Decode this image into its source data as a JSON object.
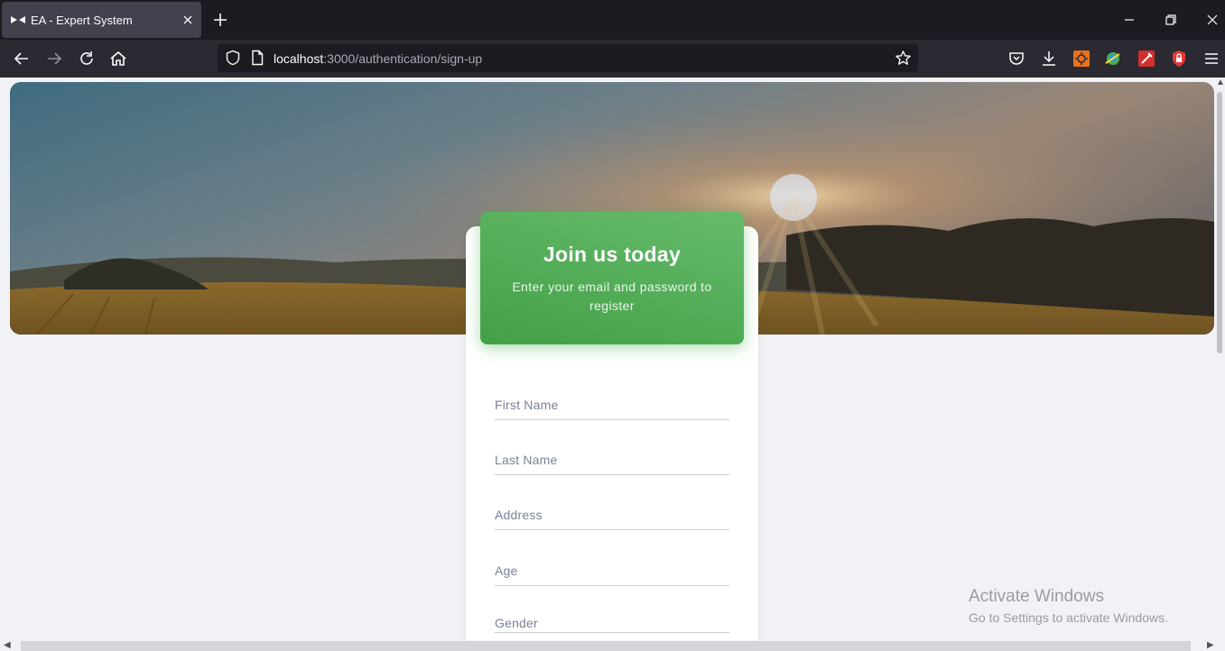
{
  "browser": {
    "tab_title": "EA - Expert System",
    "url_host": "localhost",
    "url_rest": ":3000/authentication/sign-up",
    "icons": [
      "tab-favicon-icon",
      "close-icon",
      "plus-icon",
      "minimize-icon",
      "restore-icon",
      "window-close-icon",
      "back-arrow-icon",
      "forward-arrow-icon",
      "reload-icon",
      "home-icon",
      "shield-icon",
      "page-icon",
      "star-icon",
      "pocket-icon",
      "download-icon",
      "menu-icon"
    ]
  },
  "card": {
    "title": "Join us today",
    "subtitle": "Enter your email and password to register"
  },
  "form": {
    "first_name_placeholder": "First Name",
    "last_name_placeholder": "Last Name",
    "address_placeholder": "Address",
    "age_placeholder": "Age",
    "gender_placeholder": "Gender"
  },
  "watermark": {
    "title": "Activate Windows",
    "subtitle": "Go to Settings to activate Windows."
  },
  "colors": {
    "header_green": "#4caf50",
    "chrome_dark": "#1c1b22",
    "toolbar": "#2b2a33",
    "page_bg": "#f0f2f5"
  }
}
